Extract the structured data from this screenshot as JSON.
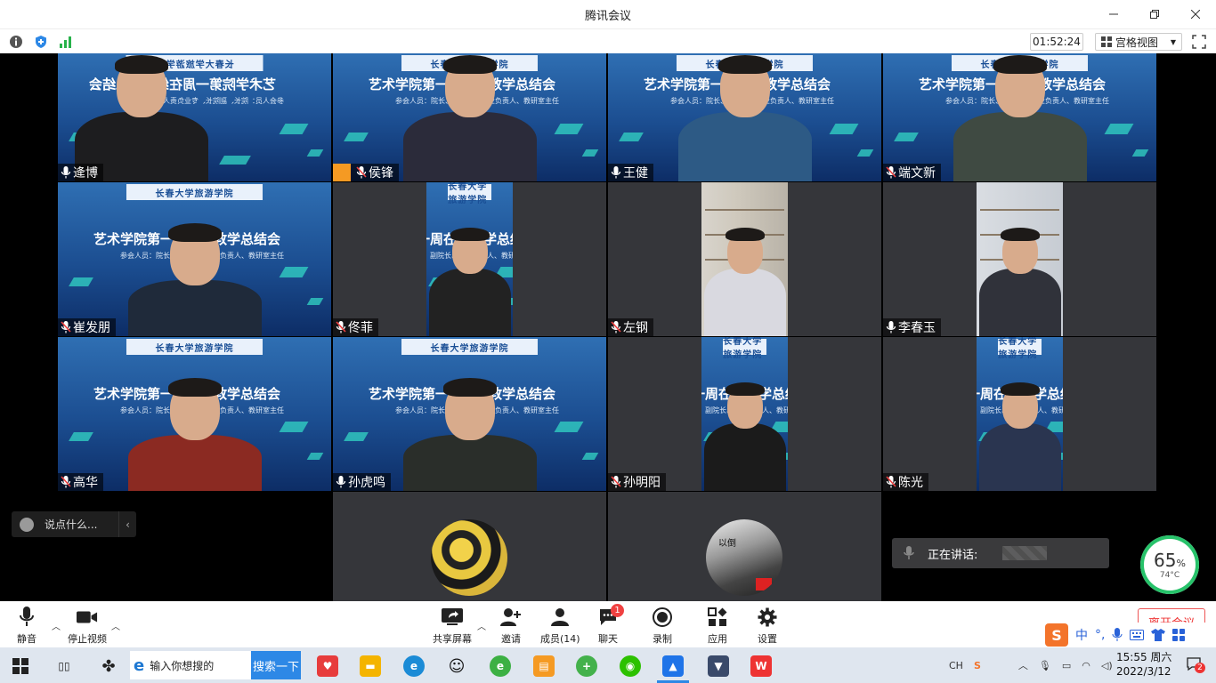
{
  "window": {
    "title": "腾讯会议"
  },
  "infobar": {
    "timer": "01:52:24",
    "view_mode": "宫格视图"
  },
  "slide": {
    "banner": "长春大学旅游学院",
    "headline": "艺术学院第一周在线教学总结会",
    "sub": "参会人员：院长、副院长、专业负责人、教研室主任"
  },
  "participants": [
    {
      "name": "逄博",
      "mic": "on"
    },
    {
      "name": "侯锋",
      "mic": "muted"
    },
    {
      "name": "王健",
      "mic": "on"
    },
    {
      "name": "端文新",
      "mic": "muted"
    },
    {
      "name": "崔发朋",
      "mic": "muted"
    },
    {
      "name": "佟菲",
      "mic": "muted"
    },
    {
      "name": "左钢",
      "mic": "muted"
    },
    {
      "name": "李春玉",
      "mic": "on"
    },
    {
      "name": "高华",
      "mic": "muted"
    },
    {
      "name": "孙虎鸣",
      "mic": "on"
    },
    {
      "name": "孙明阳",
      "mic": "muted"
    },
    {
      "name": "陈光",
      "mic": "muted"
    }
  ],
  "avatar_texts": {
    "avatar2_text": "以倒"
  },
  "chat": {
    "placeholder": "说点什么..."
  },
  "speaking": {
    "label": "正在讲话:"
  },
  "gauge": {
    "percent": "65",
    "percent_sign": "%",
    "temp": "74°C"
  },
  "toolbar": {
    "mute": "静音",
    "stop_video": "停止视频",
    "share_screen": "共享屏幕",
    "invite": "邀请",
    "members": "成员(14)",
    "chat": "聊天",
    "chat_badge": "1",
    "record": "录制",
    "apps": "应用",
    "settings": "设置",
    "leave": "离开会议"
  },
  "ime": {
    "lang": "中",
    "punct": "°,"
  },
  "taskbar": {
    "search_placeholder": "输入你想搜的",
    "search_button": "搜索一下",
    "tray_lang": "CH",
    "time": "15:55 周六",
    "date": "2022/3/12",
    "notify_count": "2"
  },
  "colors": {
    "accent": "#2d88e6",
    "slide_blue": "#1b4d90",
    "speaking_green": "#27c26a"
  }
}
